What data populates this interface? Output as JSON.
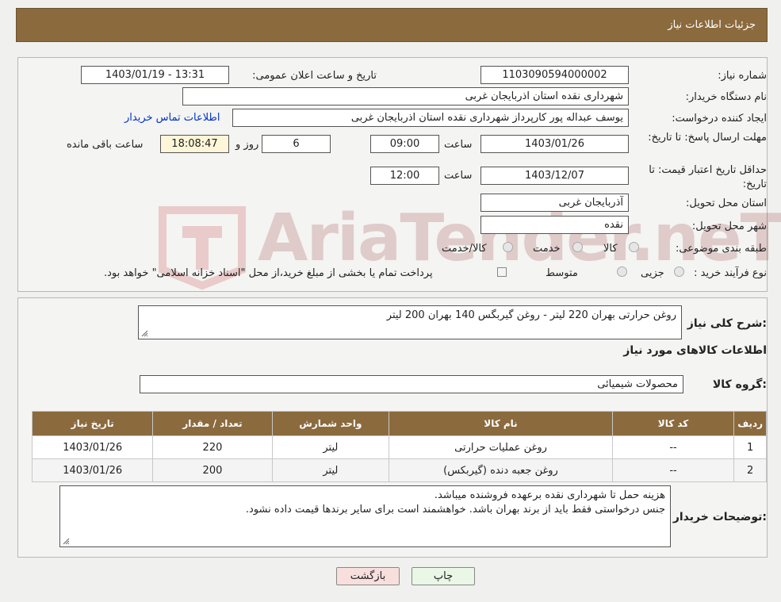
{
  "header": {
    "title": "جزئیات اطلاعات نیاز"
  },
  "labels": {
    "need_number": "شماره نیاز:",
    "announce_datetime": "تاریخ و ساعت اعلان عمومی:",
    "buyer_org": "نام دستگاه خریدار:",
    "requester": "ایجاد کننده درخواست:",
    "contact_link": "اطلاعات تماس خریدار",
    "reply_deadline": "مهلت ارسال پاسخ: تا تاریخ:",
    "price_validity": "حداقل تاریخ اعتبار قیمت: تا تاریخ:",
    "time": "ساعت",
    "day_and": "روز و",
    "time_remaining": "ساعت باقی مانده",
    "province": "استان محل تحویل:",
    "city": "شهر محل تحویل:",
    "category": "طبقه بندی موضوعی:",
    "process_type": "نوع فرآیند خرید :",
    "category_goods": "کالا",
    "category_service": "خدمت",
    "category_goods_service": "کالا/خدمت",
    "process_partial": "جزیی",
    "process_medium": "متوسط",
    "payment_note": "پرداخت تمام یا بخشی از مبلغ خرید،از محل \"اسناد خزانه اسلامی\" خواهد بود.",
    "summary": "شرح کلی نیاز:",
    "goods_info": "اطلاعات کالاهای مورد نیاز",
    "goods_group": "گروه کالا:",
    "buyer_notes": "توضیحات خریدار:"
  },
  "fields": {
    "need_number": "1103090594000002",
    "announce_datetime": "1403/01/19 - 13:31",
    "buyer_org": "شهرداری نقده استان اذربایجان غربی",
    "requester": "یوسف عبداله پور کارپرداز شهرداری نقده استان اذربایجان غربی",
    "reply_date": "1403/01/26",
    "reply_time": "09:00",
    "days_left": "6",
    "time_left": "18:08:47",
    "validity_date": "1403/12/07",
    "validity_time": "12:00",
    "province": "آذربایجان غربی",
    "city": "نقده",
    "summary": "روغن حرارتی بهران 220 لیتر - روغن گیربگس  140 بهران 200 لیتر",
    "goods_group": "محصولات شیمیائی",
    "buyer_notes_line1": "هزینه حمل تا شهرداری نقده برعهده فروشنده میباشد.",
    "buyer_notes_line2": "جنس درخواستی فقط باید از برند بهران باشد. خواهشمند است برای سایر برندها قیمت داده نشود."
  },
  "table": {
    "headers": [
      "ردیف",
      "کد کالا",
      "نام کالا",
      "واحد شمارش",
      "تعداد / مقدار",
      "تاریخ نیاز"
    ],
    "rows": [
      [
        "1",
        "--",
        "روغن عملیات حرارتی",
        "لیتر",
        "220",
        "1403/01/26"
      ],
      [
        "2",
        "--",
        "روغن جعبه دنده (گیربکس)",
        "لیتر",
        "200",
        "1403/01/26"
      ]
    ]
  },
  "buttons": {
    "print": "چاپ",
    "back": "بازگشت"
  },
  "watermark": {
    "text": "AriaTender.neT"
  },
  "colors": {
    "header_bg": "#8b6a3e",
    "print_btn": "#eaf6e6",
    "back_btn": "#f9dede",
    "link": "#0033cc"
  }
}
